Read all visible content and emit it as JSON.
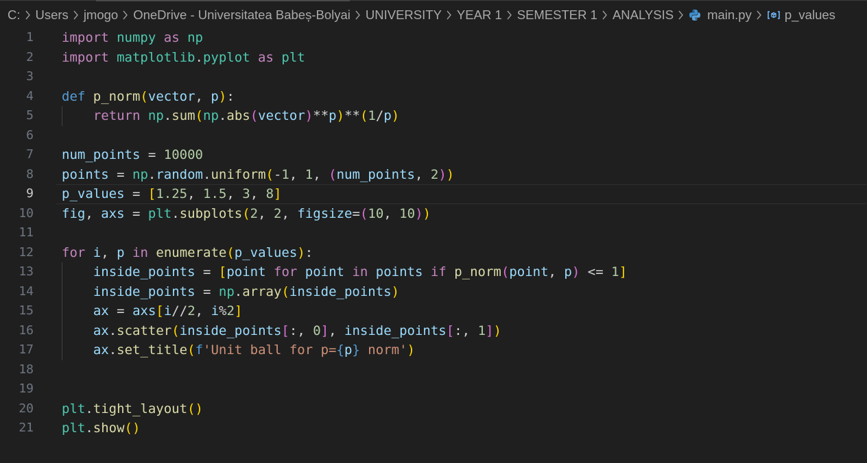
{
  "breadcrumb": {
    "items": [
      "C:",
      "Users",
      "jmogo",
      "OneDrive - Universitatea Babeș-Bolyai",
      "UNIVERSITY",
      "YEAR 1",
      "SEMESTER 1",
      "ANALYSIS"
    ],
    "file": "main.py",
    "symbol": "p_values",
    "file_icon": "python-icon",
    "symbol_icon": "variable-symbol-icon"
  },
  "editor": {
    "current_line": 9,
    "lines": [
      {
        "n": "1",
        "t": "import numpy as np"
      },
      {
        "n": "2",
        "t": "import matplotlib.pyplot as plt"
      },
      {
        "n": "3",
        "t": ""
      },
      {
        "n": "4",
        "t": "def p_norm(vector, p):"
      },
      {
        "n": "5",
        "t": "    return np.sum(np.abs(vector)**p)**(1/p)"
      },
      {
        "n": "6",
        "t": ""
      },
      {
        "n": "7",
        "t": "num_points = 10000"
      },
      {
        "n": "8",
        "t": "points = np.random.uniform(-1, 1, (num_points, 2))"
      },
      {
        "n": "9",
        "t": "p_values = [1.25, 1.5, 3, 8]"
      },
      {
        "n": "10",
        "t": "fig, axs = plt.subplots(2, 2, figsize=(10, 10))"
      },
      {
        "n": "11",
        "t": ""
      },
      {
        "n": "12",
        "t": "for i, p in enumerate(p_values):"
      },
      {
        "n": "13",
        "t": "    inside_points = [point for point in points if p_norm(point, p) <= 1]"
      },
      {
        "n": "14",
        "t": "    inside_points = np.array(inside_points)"
      },
      {
        "n": "15",
        "t": "    ax = axs[i//2, i%2]"
      },
      {
        "n": "16",
        "t": "    ax.scatter(inside_points[:, 0], inside_points[:, 1])"
      },
      {
        "n": "17",
        "t": "    ax.set_title(f'Unit ball for p={p} norm')"
      },
      {
        "n": "18",
        "t": ""
      },
      {
        "n": "19",
        "t": ""
      },
      {
        "n": "20",
        "t": "plt.tight_layout()"
      },
      {
        "n": "21",
        "t": "plt.show()"
      }
    ]
  }
}
